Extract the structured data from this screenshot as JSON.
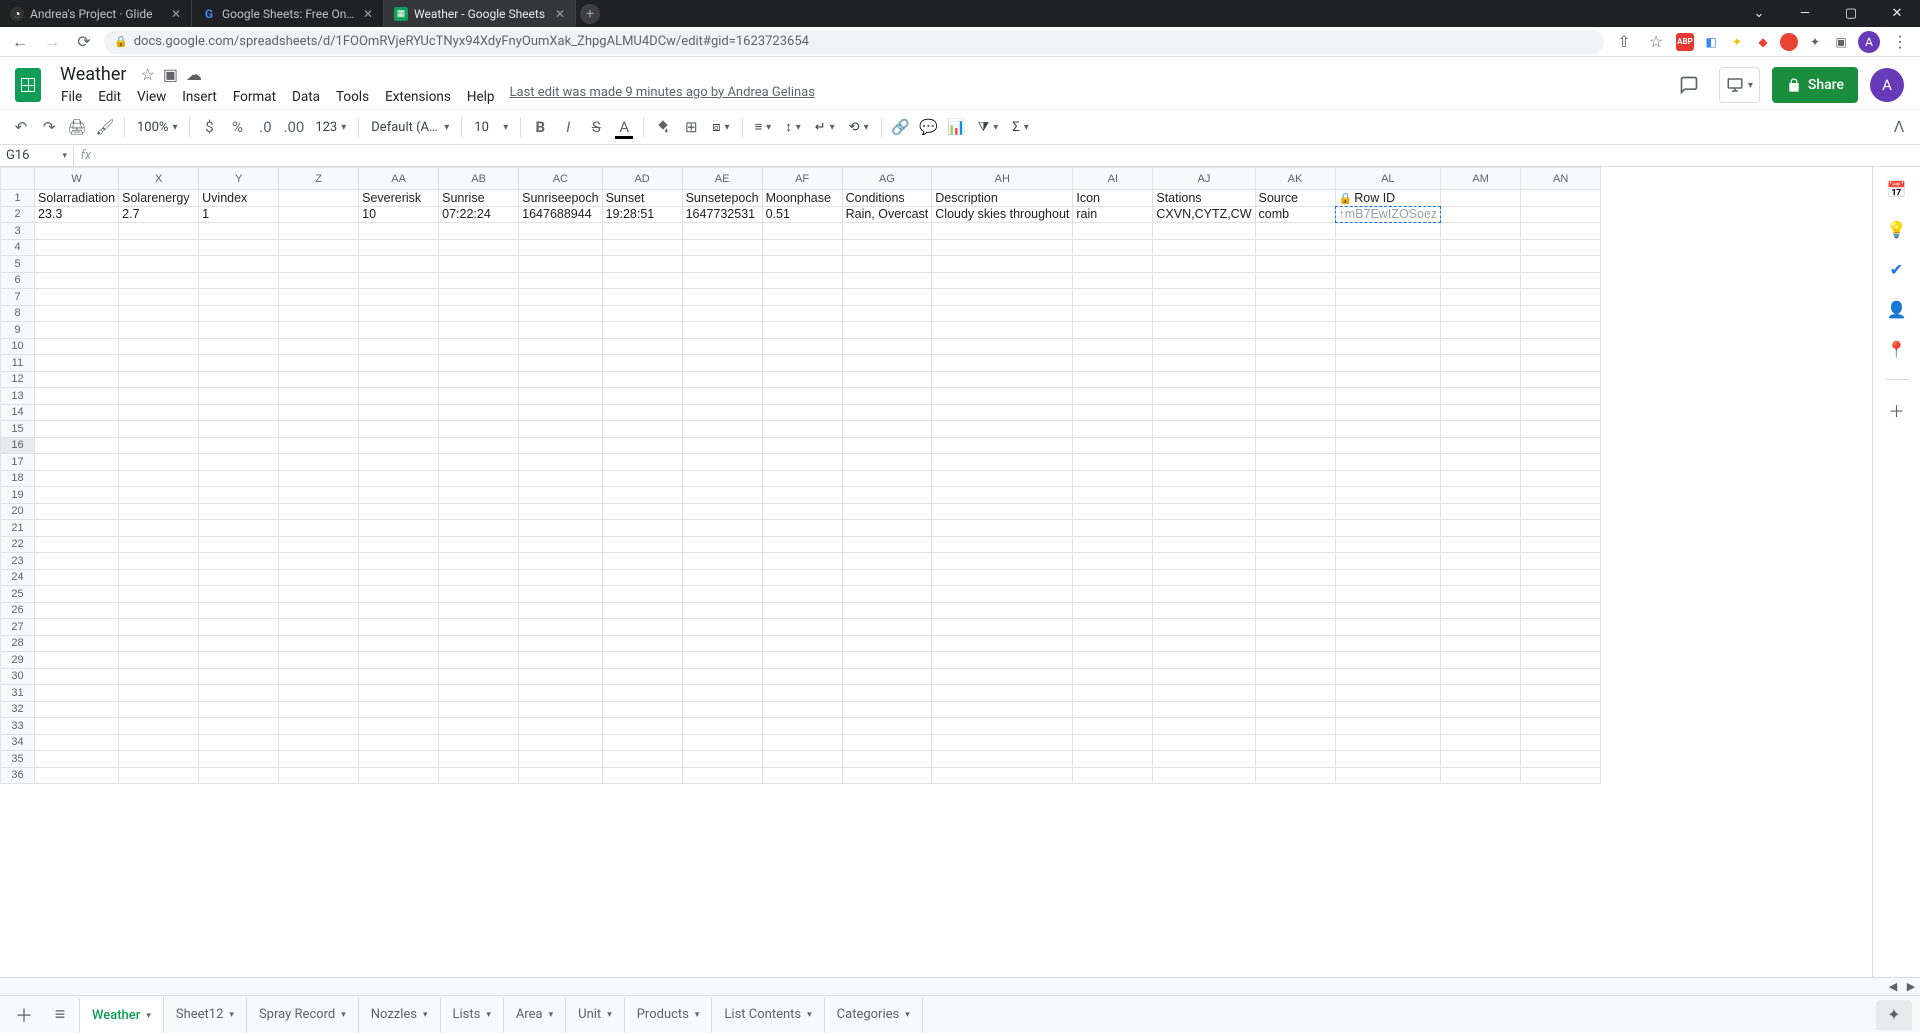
{
  "browser": {
    "tabs": [
      {
        "title": "Andrea's Project · Glide",
        "favicon": "●"
      },
      {
        "title": "Google Sheets: Free Online Spre",
        "favicon": "G"
      },
      {
        "title": "Weather - Google Sheets",
        "favicon": "▦",
        "active": true
      }
    ],
    "url": "docs.google.com/spreadsheets/d/1FOOmRVjeRYUcTNyx94XdyFnyOumXak_ZhpgALMU4DCw/edit#gid=1623723654",
    "avatar": "A"
  },
  "doc": {
    "title": "Weather",
    "menus": [
      "File",
      "Edit",
      "View",
      "Insert",
      "Format",
      "Data",
      "Tools",
      "Extensions",
      "Help"
    ],
    "last_edit": "Last edit was made 9 minutes ago by Andrea Gelinas",
    "share": "Share",
    "profile": "A"
  },
  "toolbar": {
    "zoom": "100%",
    "font": "Default (Ari...",
    "font_size": "10"
  },
  "name_box": "G16",
  "columns": [
    "W",
    "X",
    "Y",
    "Z",
    "AA",
    "AB",
    "AC",
    "AD",
    "AE",
    "AF",
    "AG",
    "AH",
    "AI",
    "AJ",
    "AK",
    "AL",
    "AM",
    "AN"
  ],
  "headers": [
    "Solarradiation",
    "Solarenergy",
    "Uvindex",
    "",
    "Severerisk",
    "Sunrise",
    "Sunriseepoch",
    "Sunset",
    "Sunsetepoch",
    "Moonphase",
    "Conditions",
    "Description",
    "Icon",
    "Stations",
    "Source",
    "🔒 Row ID",
    "",
    ""
  ],
  "row2": [
    "23.3",
    "2.7",
    "1",
    "",
    "10",
    "07:22:24",
    "1647688944",
    "19:28:51",
    "1647732531",
    "0.51",
    "Rain, Overcast",
    "Cloudy skies throughout",
    "rain",
    "CXVN,CYTZ,CW",
    "comb",
    "↑mB7EwIZOSoez",
    "",
    ""
  ],
  "num_rows": 36,
  "selected_cell": {
    "row": 16,
    "col_letter": "G"
  },
  "dashed_cell": {
    "row": 2,
    "col_index": 15
  },
  "sheet_tabs": [
    "Weather",
    "Sheet12",
    "Spray Record",
    "Nozzles",
    "Lists",
    "Area",
    "Unit",
    "Products",
    "List Contents",
    "Categories"
  ],
  "active_sheet": 0,
  "side_icons": [
    "📅",
    "💡",
    "✔",
    "👤",
    "📍",
    "",
    "+"
  ]
}
